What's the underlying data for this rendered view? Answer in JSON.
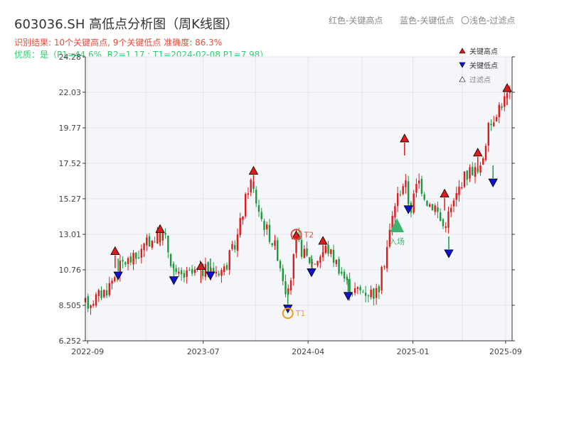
{
  "title": "603036.SH 高低点分析图（周K线图）",
  "subtitle_line1": "识别结果: 10个关键高点, 9个关键低点  准确度: 86.3%",
  "subtitle_line2": "优质：是（P1=44.6%, R2=1.17 ; T1=2024-02-08 P1=7.98）",
  "top_legend": {
    "red": "红色-关键高点",
    "blue": "蓝色-关键低点",
    "light": "〇浅色-过滤点"
  },
  "colors": {
    "up": "#e0191b",
    "down": "#1c9a3c",
    "high_marker": "#e0191b",
    "low_marker": "#1010d0",
    "entry": "#3cb371",
    "t_circle_1": "#f39c12",
    "t_circle_2": "#e74c3c",
    "plot_bg": "#f5f6fa",
    "grid": "#e3e5ea"
  },
  "chart_data": {
    "type": "candlestick",
    "title": "603036.SH 高低点分析图（周K线图）",
    "xlabel": "",
    "ylabel": "",
    "x_ticks": [
      "2022-09",
      "2023-07",
      "2024-04",
      "2025-01",
      "2025-09"
    ],
    "y_ticks": [
      6.252,
      8.505,
      10.76,
      13.01,
      15.27,
      17.52,
      19.77,
      22.03,
      24.28
    ],
    "y_tick_labels": [
      "6.252",
      "8.505",
      "10.76",
      "13.01",
      "15.27",
      "17.52",
      "19.77",
      "22.03",
      "24.28"
    ],
    "ylim": [
      6.252,
      24.28
    ],
    "grid": true,
    "candles": [],
    "anchors": [
      [
        "2022-09-01",
        8.6
      ],
      [
        "2022-10-20",
        9.5
      ],
      [
        "2022-12-01",
        11.2
      ],
      [
        "2023-01-05",
        11.5
      ],
      [
        "2023-02-10",
        12.6
      ],
      [
        "2023-03-20",
        13.0
      ],
      [
        "2023-04-20",
        10.3
      ],
      [
        "2023-05-20",
        10.4
      ],
      [
        "2023-06-25",
        10.7
      ],
      [
        "2023-07-20",
        10.7
      ],
      [
        "2023-08-25",
        10.8
      ],
      [
        "2023-09-25",
        12.5
      ],
      [
        "2023-11-01",
        16.5
      ],
      [
        "2023-12-01",
        14.0
      ],
      [
        "2024-01-10",
        12.0
      ],
      [
        "2024-02-08",
        9.0
      ],
      [
        "2024-03-01",
        12.6
      ],
      [
        "2024-03-25",
        11.6
      ],
      [
        "2024-04-15",
        11.2
      ],
      [
        "2024-05-20",
        12.2
      ],
      [
        "2024-06-20",
        11.0
      ],
      [
        "2024-07-20",
        9.5
      ],
      [
        "2024-08-25",
        9.4
      ],
      [
        "2024-10-01",
        9.3
      ],
      [
        "2024-10-20",
        11.6
      ],
      [
        "2024-11-15",
        15.0
      ],
      [
        "2024-12-10",
        16.5
      ],
      [
        "2024-12-25",
        14.5
      ],
      [
        "2025-01-15",
        16.5
      ],
      [
        "2025-02-10",
        15.0
      ],
      [
        "2025-03-01",
        14.8
      ],
      [
        "2025-03-20",
        13.5
      ],
      [
        "2025-04-15",
        14.8
      ],
      [
        "2025-05-10",
        16.5
      ],
      [
        "2025-06-05",
        17.2
      ],
      [
        "2025-06-25",
        16.8
      ],
      [
        "2025-07-15",
        19.5
      ],
      [
        "2025-08-10",
        21.0
      ],
      [
        "2025-09-05",
        21.8
      ]
    ],
    "key_highs": [
      {
        "date": "2022-11-12",
        "value": 11.95
      },
      {
        "date": "2023-03-10",
        "value": 13.35
      },
      {
        "date": "2023-06-25",
        "value": 11.0
      },
      {
        "date": "2023-11-10",
        "value": 17.05
      },
      {
        "date": "2024-03-01",
        "value": 12.95
      },
      {
        "date": "2024-05-10",
        "value": 12.6
      },
      {
        "date": "2024-12-10",
        "value": 19.1
      },
      {
        "date": "2025-03-25",
        "value": 15.6
      },
      {
        "date": "2025-06-20",
        "value": 18.2
      },
      {
        "date": "2025-09-05",
        "value": 22.3
      }
    ],
    "key_lows": [
      {
        "date": "2022-11-20",
        "value": 10.4
      },
      {
        "date": "2023-04-15",
        "value": 10.1
      },
      {
        "date": "2023-07-20",
        "value": 10.4
      },
      {
        "date": "2024-02-08",
        "value": 8.3
      },
      {
        "date": "2024-04-10",
        "value": 10.6
      },
      {
        "date": "2024-07-15",
        "value": 9.1
      },
      {
        "date": "2024-12-20",
        "value": 14.6
      },
      {
        "date": "2025-04-05",
        "value": 11.8
      },
      {
        "date": "2025-07-30",
        "value": 16.3
      }
    ],
    "legend": [
      "关键高点",
      "关键低点",
      "过滤点"
    ],
    "legend_position": "top-right",
    "annotations": [
      {
        "label": "T1",
        "date": "2024-02-08",
        "value": 8.0
      },
      {
        "label": "T2",
        "date": "2024-03-01",
        "value": 13.0
      },
      {
        "label": "入场",
        "date": "2024-11-20",
        "value": 13.5
      }
    ]
  }
}
